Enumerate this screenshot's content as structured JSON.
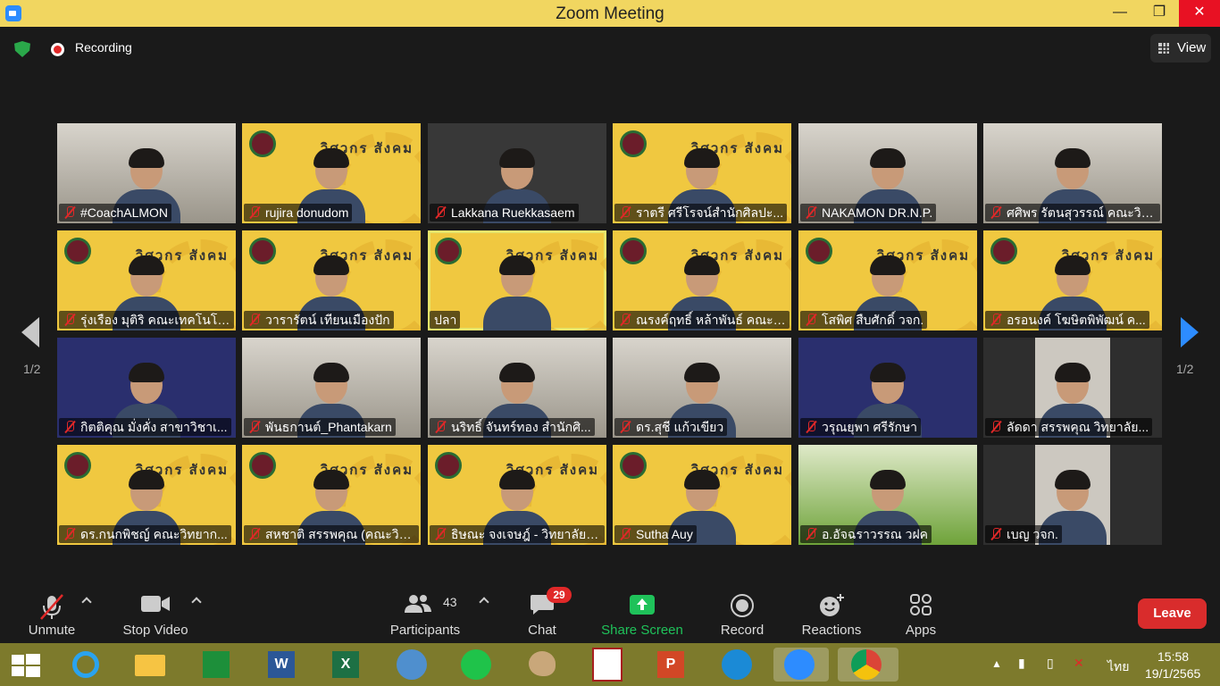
{
  "window": {
    "title": "Zoom Meeting",
    "minimize": "—",
    "maximize": "❐",
    "close": "✕"
  },
  "topbar": {
    "recording": "Recording",
    "view": "View"
  },
  "participants": [
    {
      "name": "#CoachALMON",
      "muted": true,
      "bg": "photo"
    },
    {
      "name": "rujira donudom",
      "muted": true,
      "bg": "yellow"
    },
    {
      "name": "Lakkana Ruekkasaem",
      "muted": true,
      "bg": "gray"
    },
    {
      "name": "ราตรี   ศรีโรจน์สำนักศิลปะ...",
      "muted": true,
      "bg": "yellow"
    },
    {
      "name": "NAKAMON DR.N.P.",
      "muted": true,
      "bg": "photo"
    },
    {
      "name": "ศศิพร รัตนสุวรรณ์ คณะวิท...",
      "muted": true,
      "bg": "photo"
    },
    {
      "name": "รุ่งเรือง มุติริ คณะเทคโนโลย...",
      "muted": true,
      "bg": "yellow"
    },
    {
      "name": "วารารัตน์ เทียนเมืองปัก",
      "muted": true,
      "bg": "yellow"
    },
    {
      "name": "ปลา",
      "muted": false,
      "bg": "yellow",
      "active": true
    },
    {
      "name": "ณรงค์ฤทธิ์ หล้าพันธ์ คณะว...",
      "muted": true,
      "bg": "yellow"
    },
    {
      "name": "โสพิศ สืบศักดิ์ วจก.",
      "muted": true,
      "bg": "yellow"
    },
    {
      "name": "อรอนงค์ โฆษิตพิพัฒน์ ค...",
      "muted": true,
      "bg": "yellow"
    },
    {
      "name": "กิตติคุณ  มั่งคั่ง สาขาวิชาเ...",
      "muted": true,
      "bg": "blue"
    },
    {
      "name": "พันธกานต์_Phantakarn",
      "muted": true,
      "bg": "photo"
    },
    {
      "name": "นริทธิ์ จันทร์ทอง สำนักศิ...",
      "muted": true,
      "bg": "photo"
    },
    {
      "name": "ดร.สุชี  แก้วเขียว",
      "muted": true,
      "bg": "photo"
    },
    {
      "name": "วรุณยุพา ศรีรักษา",
      "muted": true,
      "bg": "blue"
    },
    {
      "name": "ลัดดา สรรพคุณ  วิทยาลัย...",
      "muted": true,
      "bg": "dark"
    },
    {
      "name": "ดร.กนกพิชญ์ คณะวิทยาก...",
      "muted": true,
      "bg": "yellow"
    },
    {
      "name": "สหชาติ สรรพคุณ (คณะวิท...",
      "muted": true,
      "bg": "yellow"
    },
    {
      "name": "ธิษณะ จงเจษฎ์ - วิทยาลัยก...",
      "muted": true,
      "bg": "yellow"
    },
    {
      "name": "Sutha Auy",
      "muted": true,
      "bg": "yellow"
    },
    {
      "name": "อ.อัจฉราวรรณ วฝค",
      "muted": true,
      "bg": "green"
    },
    {
      "name": "เบญ วจก.",
      "muted": true,
      "bg": "dark"
    }
  ],
  "yellow_bg_text": "วิศวกร สังคม",
  "pager": {
    "left": "1/2",
    "right": "1/2"
  },
  "toolbar": {
    "unmute": "Unmute",
    "stop_video": "Stop Video",
    "participants": "Participants",
    "participant_count": "43",
    "chat": "Chat",
    "chat_badge": "29",
    "share_screen": "Share Screen",
    "record": "Record",
    "reactions": "Reactions",
    "apps": "Apps",
    "leave": "Leave"
  },
  "taskbar": {
    "time": "15:58",
    "date": "19/1/2565",
    "lang": "ไทย"
  },
  "colors": {
    "title_bar": "#f1d660",
    "accent": "#2d8cff",
    "share_green": "#1fc25a",
    "leave_red": "#d92c2c",
    "taskbar": "#7d7a2c"
  }
}
